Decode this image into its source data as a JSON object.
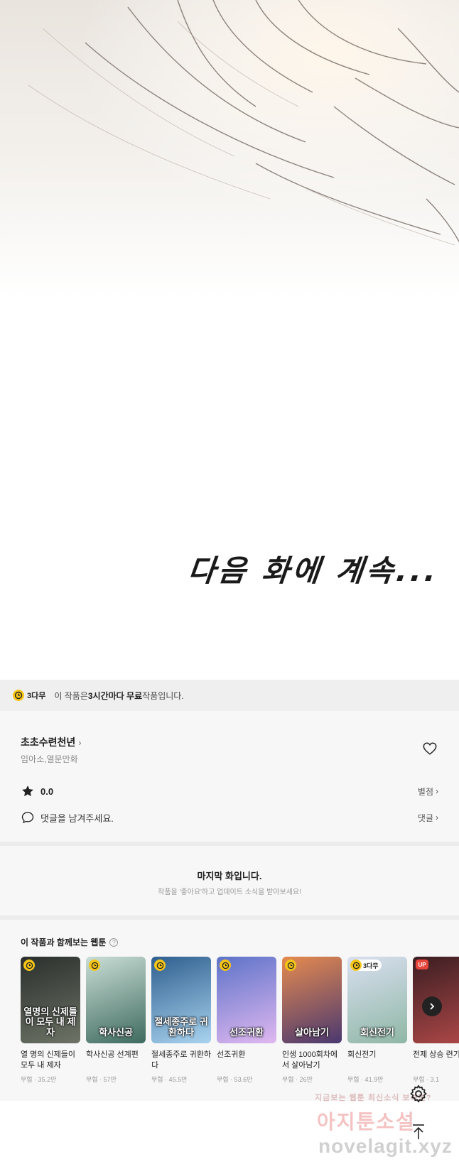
{
  "comic": {
    "caption": "다음 화에 계속..."
  },
  "free_banner": {
    "badge": "3다무",
    "text_prefix": "이 작품은 ",
    "text_bold": "3시간마다 무료",
    "text_suffix": " 작품입니다."
  },
  "series": {
    "title": "초초수련천년",
    "chevron": "›",
    "authors": "임아소,열문만화",
    "rating": "0.0",
    "rating_link": "별점",
    "comment_placeholder": "댓글을 남겨주세요.",
    "comment_link": "댓글",
    "link_chevron": "›"
  },
  "last_episode": {
    "title": "마지막 화입니다.",
    "subtitle": "작품을 '좋아요'하고 업데이트 소식을 받아보세요!"
  },
  "recommendations": {
    "heading": "이 작품과 함께보는 웹툰",
    "help": "?",
    "items": [
      {
        "title": "열 명의 신제들이 모두 내 제자",
        "cover_text": "열명의 신제들이 모두 내 제자",
        "meta": "무협 · 35.2만",
        "badge": "clock",
        "colors": [
          "#2a2f2c",
          "#6d7466"
        ]
      },
      {
        "title": "학사신공 선계편",
        "cover_text": "학사신공",
        "meta": "무협 · 57만",
        "badge": "clock",
        "colors": [
          "#c9ddd6",
          "#3f6b5e"
        ]
      },
      {
        "title": "절세종주로 귀환하다",
        "cover_text": "절세종주로 귀환하다",
        "meta": "무협 · 45.5만",
        "badge": "clock",
        "colors": [
          "#2f5f8f",
          "#a9d3ef"
        ]
      },
      {
        "title": "선조귀환",
        "cover_text": "선조귀환",
        "meta": "무협 · 53.6만",
        "badge": "clock",
        "colors": [
          "#5d73c9",
          "#e0b8f0"
        ]
      },
      {
        "title": "인생 1000회차에서 살아남기",
        "cover_text": "살아남기",
        "meta": "무협 · 26만",
        "badge": "clock",
        "colors": [
          "#e58a4f",
          "#4a3870"
        ]
      },
      {
        "title": "회신전기",
        "cover_text": "회신전기",
        "meta": "무협 · 41.9만",
        "badge": "3다무",
        "colors": [
          "#d9dff0",
          "#8fb7a5"
        ]
      },
      {
        "title": "전제 상승 련기",
        "cover_text": "",
        "meta": "무협 · 3.1",
        "badge": "UP",
        "colors": [
          "#3a1e22",
          "#b04848"
        ]
      }
    ]
  },
  "watermark": {
    "line1": "지금보는 웹툰 최신소식 보려면?",
    "line2": "아지툰소설",
    "line3": "novelagit.xyz"
  },
  "colors": {
    "badge_yellow": "#f5c518",
    "up_red": "#e8453c",
    "panel_bg": "#f7f7f7"
  }
}
